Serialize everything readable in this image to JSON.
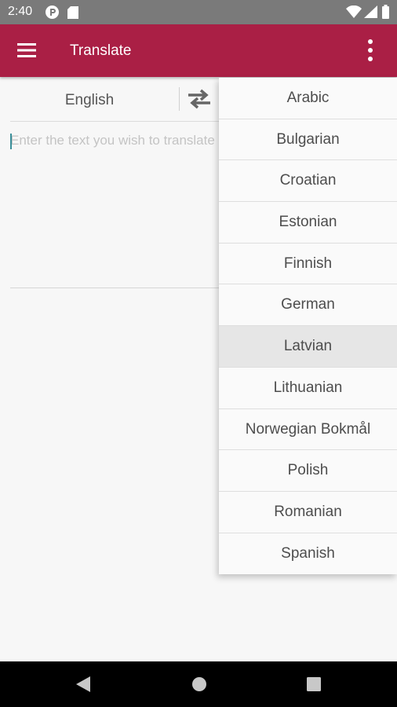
{
  "status_bar": {
    "time": "2:40",
    "icons": [
      "p-notification-icon",
      "sd-card-icon",
      "wifi-icon",
      "signal-icon",
      "battery-icon"
    ]
  },
  "toolbar": {
    "title": "Translate",
    "menu_icon": "hamburger-menu-icon",
    "more_icon": "more-vert-icon",
    "color": "#aa1f45"
  },
  "translator": {
    "source_language": "English",
    "swap_icon": "swap-arrows-icon",
    "input_placeholder": "Enter the text you wish to translate"
  },
  "dropdown": {
    "items": [
      {
        "label": "Arabic"
      },
      {
        "label": "Bulgarian"
      },
      {
        "label": "Croatian"
      },
      {
        "label": "Estonian"
      },
      {
        "label": "Finnish"
      },
      {
        "label": "German"
      },
      {
        "label": "Latvian"
      },
      {
        "label": "Lithuanian"
      },
      {
        "label": "Norwegian Bokmål"
      },
      {
        "label": "Polish"
      },
      {
        "label": "Romanian"
      },
      {
        "label": "Spanish"
      }
    ],
    "highlighted": "Latvian"
  },
  "nav_bar": {
    "icons": [
      "back-icon",
      "home-icon",
      "recents-icon"
    ]
  }
}
